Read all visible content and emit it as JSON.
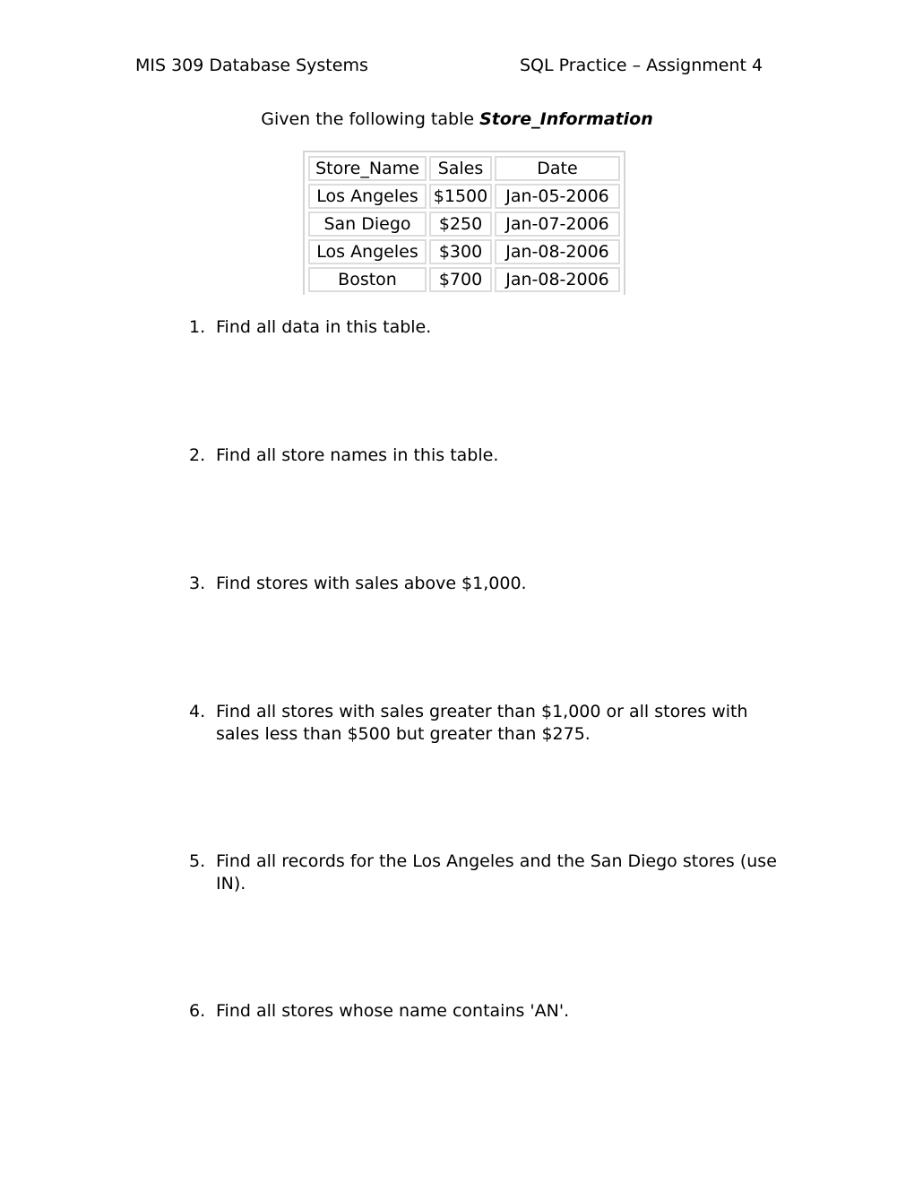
{
  "header": {
    "course": "MIS 309 Database Systems",
    "assignment": "SQL Practice – Assignment 4"
  },
  "intro": {
    "prefix": "Given the following table ",
    "table_name": "Store_Information"
  },
  "table": {
    "columns": [
      "Store_Name",
      "Sales",
      "Date"
    ],
    "rows": [
      [
        "Los Angeles",
        "$1500",
        "Jan-05-2006"
      ],
      [
        "San Diego",
        "$250",
        "Jan-07-2006"
      ],
      [
        "Los Angeles",
        "$300",
        "Jan-08-2006"
      ],
      [
        "Boston",
        "$700",
        "Jan-08-2006"
      ]
    ]
  },
  "questions": [
    {
      "number": "1.",
      "text": "Find all data in this table."
    },
    {
      "number": "2.",
      "text": "Find all store names in this table."
    },
    {
      "number": "3.",
      "text": "Find stores with sales above $1,000."
    },
    {
      "number": "4.",
      "text": "Find all stores with sales greater than $1,000 or all stores with sales less than $500 but greater than $275."
    },
    {
      "number": "5.",
      "text": "Find all records for the Los Angeles and the San Diego stores (use IN)."
    },
    {
      "number": "6.",
      "text": "Find all stores whose name contains 'AN'."
    }
  ]
}
